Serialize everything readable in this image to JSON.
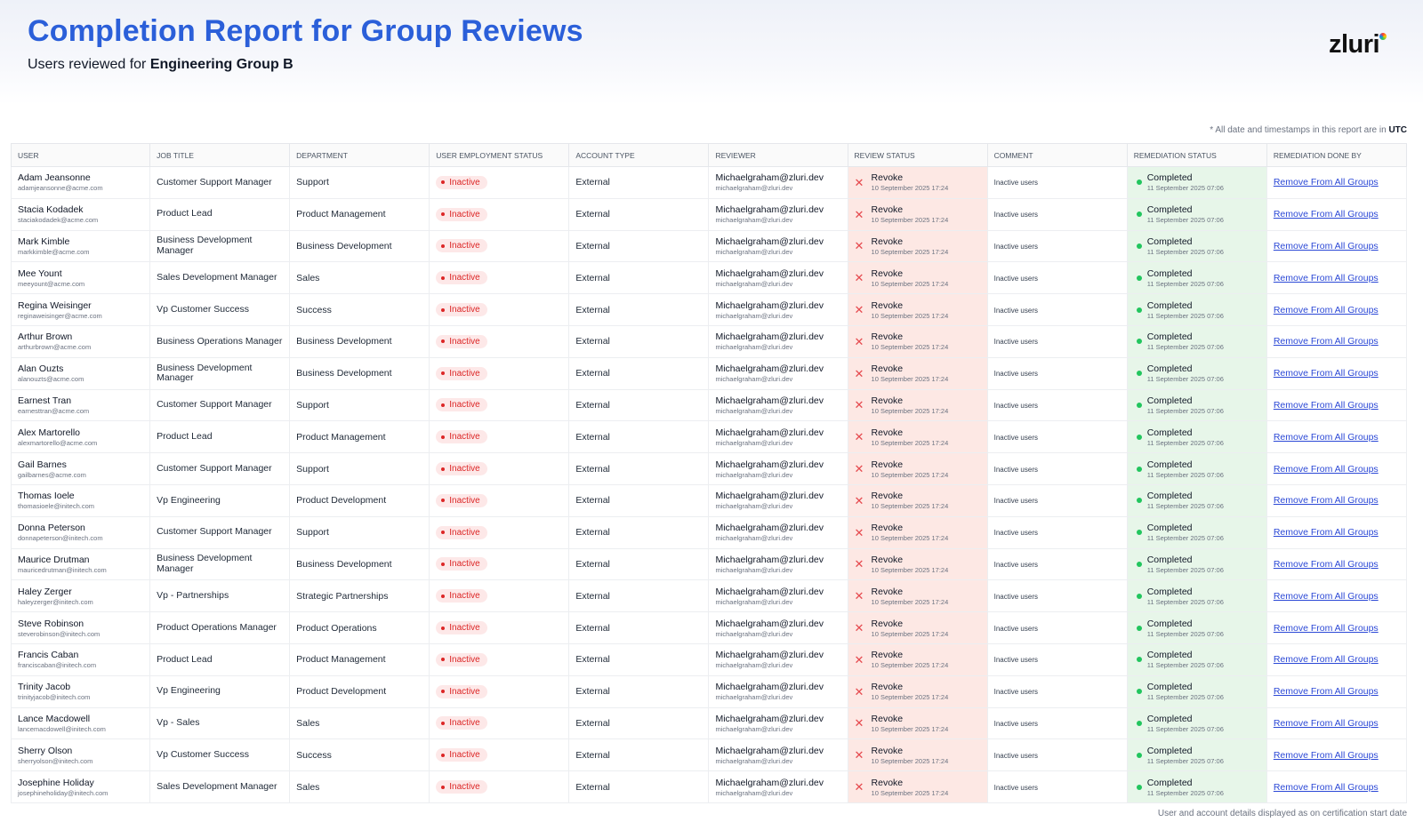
{
  "header": {
    "title": "Completion Report for Group Reviews",
    "subtitle_prefix": "Users reviewed for ",
    "subtitle_group": "Engineering Group B",
    "logo": "zluri"
  },
  "note": {
    "text": "* All date and timestamps in this report are in ",
    "tz": "UTC"
  },
  "footer_note": "User and account details displayed as on certification start date",
  "columns": [
    "User",
    "Job Title",
    "Department",
    "User Employment Status",
    "Account Type",
    "Reviewer",
    "Review Status",
    "Comment",
    "Remediation Status",
    "Remediation Done By"
  ],
  "colors": {
    "accent": "#2b5fd9",
    "inactive": "#dc2626",
    "revoke_bg": "#fde8e4",
    "completed_bg": "#e7f6e9",
    "link": "#2b48d6"
  },
  "rows": [
    {
      "name": "Adam Jeansonne",
      "email": "adamjeansonne@acme.com",
      "job": "Customer Support Manager",
      "dept": "Support",
      "emp_status": "Inactive",
      "account": "External",
      "reviewer": "Michaelgraham@zluri.dev",
      "reviewer_email": "michaelgraham@zluri.dev",
      "review": "Revoke",
      "review_date": "10 September 2025 17:24",
      "comment": "Inactive users",
      "remed": "Completed",
      "remed_date": "11 September 2025 07:06",
      "done_by": "Remove From All Groups"
    },
    {
      "name": "Stacia Kodadek",
      "email": "staciakodadek@acme.com",
      "job": "Product Lead",
      "dept": "Product Management",
      "emp_status": "Inactive",
      "account": "External",
      "reviewer": "Michaelgraham@zluri.dev",
      "reviewer_email": "michaelgraham@zluri.dev",
      "review": "Revoke",
      "review_date": "10 September 2025 17:24",
      "comment": "Inactive users",
      "remed": "Completed",
      "remed_date": "11 September 2025 07:06",
      "done_by": "Remove From All Groups"
    },
    {
      "name": "Mark Kimble",
      "email": "markkimble@acme.com",
      "job": "Business Development Manager",
      "dept": "Business Development",
      "emp_status": "Inactive",
      "account": "External",
      "reviewer": "Michaelgraham@zluri.dev",
      "reviewer_email": "michaelgraham@zluri.dev",
      "review": "Revoke",
      "review_date": "10 September 2025 17:24",
      "comment": "Inactive users",
      "remed": "Completed",
      "remed_date": "11 September 2025 07:06",
      "done_by": "Remove From All Groups"
    },
    {
      "name": "Mee Yount",
      "email": "meeyount@acme.com",
      "job": "Sales Development Manager",
      "dept": "Sales",
      "emp_status": "Inactive",
      "account": "External",
      "reviewer": "Michaelgraham@zluri.dev",
      "reviewer_email": "michaelgraham@zluri.dev",
      "review": "Revoke",
      "review_date": "10 September 2025 17:24",
      "comment": "Inactive users",
      "remed": "Completed",
      "remed_date": "11 September 2025 07:06",
      "done_by": "Remove From All Groups"
    },
    {
      "name": "Regina Weisinger",
      "email": "reginaweisinger@acme.com",
      "job": "Vp Customer Success",
      "dept": "Success",
      "emp_status": "Inactive",
      "account": "External",
      "reviewer": "Michaelgraham@zluri.dev",
      "reviewer_email": "michaelgraham@zluri.dev",
      "review": "Revoke",
      "review_date": "10 September 2025 17:24",
      "comment": "Inactive users",
      "remed": "Completed",
      "remed_date": "11 September 2025 07:06",
      "done_by": "Remove From All Groups"
    },
    {
      "name": "Arthur Brown",
      "email": "arthurbrown@acme.com",
      "job": "Business Operations Manager",
      "dept": "Business Development",
      "emp_status": "Inactive",
      "account": "External",
      "reviewer": "Michaelgraham@zluri.dev",
      "reviewer_email": "michaelgraham@zluri.dev",
      "review": "Revoke",
      "review_date": "10 September 2025 17:24",
      "comment": "Inactive users",
      "remed": "Completed",
      "remed_date": "11 September 2025 07:06",
      "done_by": "Remove From All Groups"
    },
    {
      "name": "Alan Ouzts",
      "email": "alanouzts@acme.com",
      "job": "Business Development Manager",
      "dept": "Business Development",
      "emp_status": "Inactive",
      "account": "External",
      "reviewer": "Michaelgraham@zluri.dev",
      "reviewer_email": "michaelgraham@zluri.dev",
      "review": "Revoke",
      "review_date": "10 September 2025 17:24",
      "comment": "Inactive users",
      "remed": "Completed",
      "remed_date": "11 September 2025 07:06",
      "done_by": "Remove From All Groups"
    },
    {
      "name": "Earnest Tran",
      "email": "earnesttran@acme.com",
      "job": "Customer Support Manager",
      "dept": "Support",
      "emp_status": "Inactive",
      "account": "External",
      "reviewer": "Michaelgraham@zluri.dev",
      "reviewer_email": "michaelgraham@zluri.dev",
      "review": "Revoke",
      "review_date": "10 September 2025 17:24",
      "comment": "Inactive users",
      "remed": "Completed",
      "remed_date": "11 September 2025 07:06",
      "done_by": "Remove From All Groups"
    },
    {
      "name": "Alex Martorello",
      "email": "alexmartorello@acme.com",
      "job": "Product Lead",
      "dept": "Product Management",
      "emp_status": "Inactive",
      "account": "External",
      "reviewer": "Michaelgraham@zluri.dev",
      "reviewer_email": "michaelgraham@zluri.dev",
      "review": "Revoke",
      "review_date": "10 September 2025 17:24",
      "comment": "Inactive users",
      "remed": "Completed",
      "remed_date": "11 September 2025 07:06",
      "done_by": "Remove From All Groups"
    },
    {
      "name": "Gail Barnes",
      "email": "gailbarnes@acme.com",
      "job": "Customer Support Manager",
      "dept": "Support",
      "emp_status": "Inactive",
      "account": "External",
      "reviewer": "Michaelgraham@zluri.dev",
      "reviewer_email": "michaelgraham@zluri.dev",
      "review": "Revoke",
      "review_date": "10 September 2025 17:24",
      "comment": "Inactive users",
      "remed": "Completed",
      "remed_date": "11 September 2025 07:06",
      "done_by": "Remove From All Groups"
    },
    {
      "name": "Thomas Ioele",
      "email": "thomasioele@initech.com",
      "job": "Vp Engineering",
      "dept": "Product Development",
      "emp_status": "Inactive",
      "account": "External",
      "reviewer": "Michaelgraham@zluri.dev",
      "reviewer_email": "michaelgraham@zluri.dev",
      "review": "Revoke",
      "review_date": "10 September 2025 17:24",
      "comment": "Inactive users",
      "remed": "Completed",
      "remed_date": "11 September 2025 07:06",
      "done_by": "Remove From All Groups"
    },
    {
      "name": "Donna Peterson",
      "email": "donnapeterson@initech.com",
      "job": "Customer Support Manager",
      "dept": "Support",
      "emp_status": "Inactive",
      "account": "External",
      "reviewer": "Michaelgraham@zluri.dev",
      "reviewer_email": "michaelgraham@zluri.dev",
      "review": "Revoke",
      "review_date": "10 September 2025 17:24",
      "comment": "Inactive users",
      "remed": "Completed",
      "remed_date": "11 September 2025 07:06",
      "done_by": "Remove From All Groups"
    },
    {
      "name": "Maurice Drutman",
      "email": "mauricedrutman@initech.com",
      "job": "Business Development Manager",
      "dept": "Business Development",
      "emp_status": "Inactive",
      "account": "External",
      "reviewer": "Michaelgraham@zluri.dev",
      "reviewer_email": "michaelgraham@zluri.dev",
      "review": "Revoke",
      "review_date": "10 September 2025 17:24",
      "comment": "Inactive users",
      "remed": "Completed",
      "remed_date": "11 September 2025 07:06",
      "done_by": "Remove From All Groups"
    },
    {
      "name": "Haley Zerger",
      "email": "haleyzerger@initech.com",
      "job": "Vp - Partnerships",
      "dept": "Strategic Partnerships",
      "emp_status": "Inactive",
      "account": "External",
      "reviewer": "Michaelgraham@zluri.dev",
      "reviewer_email": "michaelgraham@zluri.dev",
      "review": "Revoke",
      "review_date": "10 September 2025 17:24",
      "comment": "Inactive users",
      "remed": "Completed",
      "remed_date": "11 September 2025 07:06",
      "done_by": "Remove From All Groups"
    },
    {
      "name": "Steve Robinson",
      "email": "steverobinson@initech.com",
      "job": "Product Operations Manager",
      "dept": "Product Operations",
      "emp_status": "Inactive",
      "account": "External",
      "reviewer": "Michaelgraham@zluri.dev",
      "reviewer_email": "michaelgraham@zluri.dev",
      "review": "Revoke",
      "review_date": "10 September 2025 17:24",
      "comment": "Inactive users",
      "remed": "Completed",
      "remed_date": "11 September 2025 07:06",
      "done_by": "Remove From All Groups"
    },
    {
      "name": "Francis Caban",
      "email": "franciscaban@initech.com",
      "job": "Product Lead",
      "dept": "Product Management",
      "emp_status": "Inactive",
      "account": "External",
      "reviewer": "Michaelgraham@zluri.dev",
      "reviewer_email": "michaelgraham@zluri.dev",
      "review": "Revoke",
      "review_date": "10 September 2025 17:24",
      "comment": "Inactive users",
      "remed": "Completed",
      "remed_date": "11 September 2025 07:06",
      "done_by": "Remove From All Groups"
    },
    {
      "name": "Trinity Jacob",
      "email": "trinityjacob@initech.com",
      "job": "Vp Engineering",
      "dept": "Product Development",
      "emp_status": "Inactive",
      "account": "External",
      "reviewer": "Michaelgraham@zluri.dev",
      "reviewer_email": "michaelgraham@zluri.dev",
      "review": "Revoke",
      "review_date": "10 September 2025 17:24",
      "comment": "Inactive users",
      "remed": "Completed",
      "remed_date": "11 September 2025 07:06",
      "done_by": "Remove From All Groups"
    },
    {
      "name": "Lance Macdowell",
      "email": "lancemacdowell@initech.com",
      "job": "Vp - Sales",
      "dept": "Sales",
      "emp_status": "Inactive",
      "account": "External",
      "reviewer": "Michaelgraham@zluri.dev",
      "reviewer_email": "michaelgraham@zluri.dev",
      "review": "Revoke",
      "review_date": "10 September 2025 17:24",
      "comment": "Inactive users",
      "remed": "Completed",
      "remed_date": "11 September 2025 07:06",
      "done_by": "Remove From All Groups"
    },
    {
      "name": "Sherry Olson",
      "email": "sherryolson@initech.com",
      "job": "Vp Customer Success",
      "dept": "Success",
      "emp_status": "Inactive",
      "account": "External",
      "reviewer": "Michaelgraham@zluri.dev",
      "reviewer_email": "michaelgraham@zluri.dev",
      "review": "Revoke",
      "review_date": "10 September 2025 17:24",
      "comment": "Inactive users",
      "remed": "Completed",
      "remed_date": "11 September 2025 07:06",
      "done_by": "Remove From All Groups"
    },
    {
      "name": "Josephine Holiday",
      "email": "josephineholiday@initech.com",
      "job": "Sales Development Manager",
      "dept": "Sales",
      "emp_status": "Inactive",
      "account": "External",
      "reviewer": "Michaelgraham@zluri.dev",
      "reviewer_email": "michaelgraham@zluri.dev",
      "review": "Revoke",
      "review_date": "10 September 2025 17:24",
      "comment": "Inactive users",
      "remed": "Completed",
      "remed_date": "11 September 2025 07:06",
      "done_by": "Remove From All Groups"
    }
  ]
}
